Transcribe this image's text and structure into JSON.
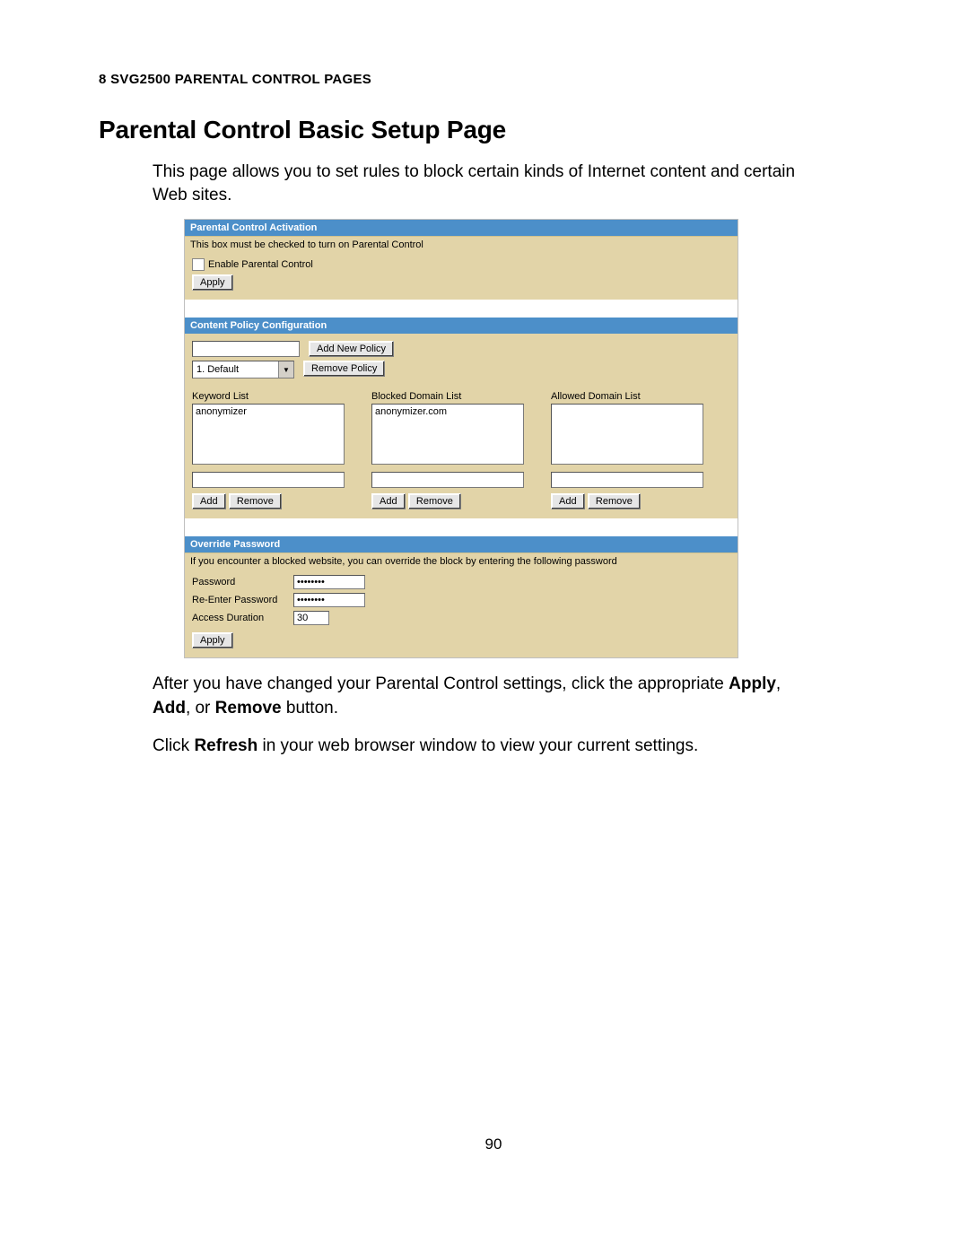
{
  "chapter": "8 SVG2500 PARENTAL CONTROL PAGES",
  "heading": "Parental Control Basic Setup Page",
  "intro": "This page allows you to set rules to block certain kinds of Internet content and certain Web sites.",
  "ui": {
    "activation": {
      "title": "Parental Control Activation",
      "notice": "This box must be checked to turn on Parental Control",
      "check_label": "Enable Parental Control",
      "apply": "Apply"
    },
    "policy": {
      "title": "Content Policy Configuration",
      "add_btn": "Add New Policy",
      "select": "1. Default",
      "remove_btn": "Remove Policy",
      "cols": {
        "kw_label": "Keyword List",
        "kw_item": "anonymizer",
        "bl_label": "Blocked Domain List",
        "bl_item": "anonymizer.com",
        "al_label": "Allowed Domain List"
      },
      "add": "Add",
      "remove": "Remove"
    },
    "override": {
      "title": "Override Password",
      "notice": "If you encounter a blocked website, you can override the block by entering the following password",
      "pass_label": "Password",
      "pass_val": "••••••••",
      "re_label": "Re-Enter Password",
      "re_val": "••••••••",
      "dur_label": "Access Duration",
      "dur_val": "30",
      "apply": "Apply"
    }
  },
  "outro1_a": "After you have changed your Parental Control settings, click the appropriate ",
  "outro1_b": "Apply",
  "outro1_c": ", ",
  "outro1_d": "Add",
  "outro1_e": ", or ",
  "outro1_f": "Remove",
  "outro1_g": " button.",
  "outro2_a": "Click ",
  "outro2_b": "Refresh",
  "outro2_c": " in your web browser window to view your current settings.",
  "page_number": "90"
}
